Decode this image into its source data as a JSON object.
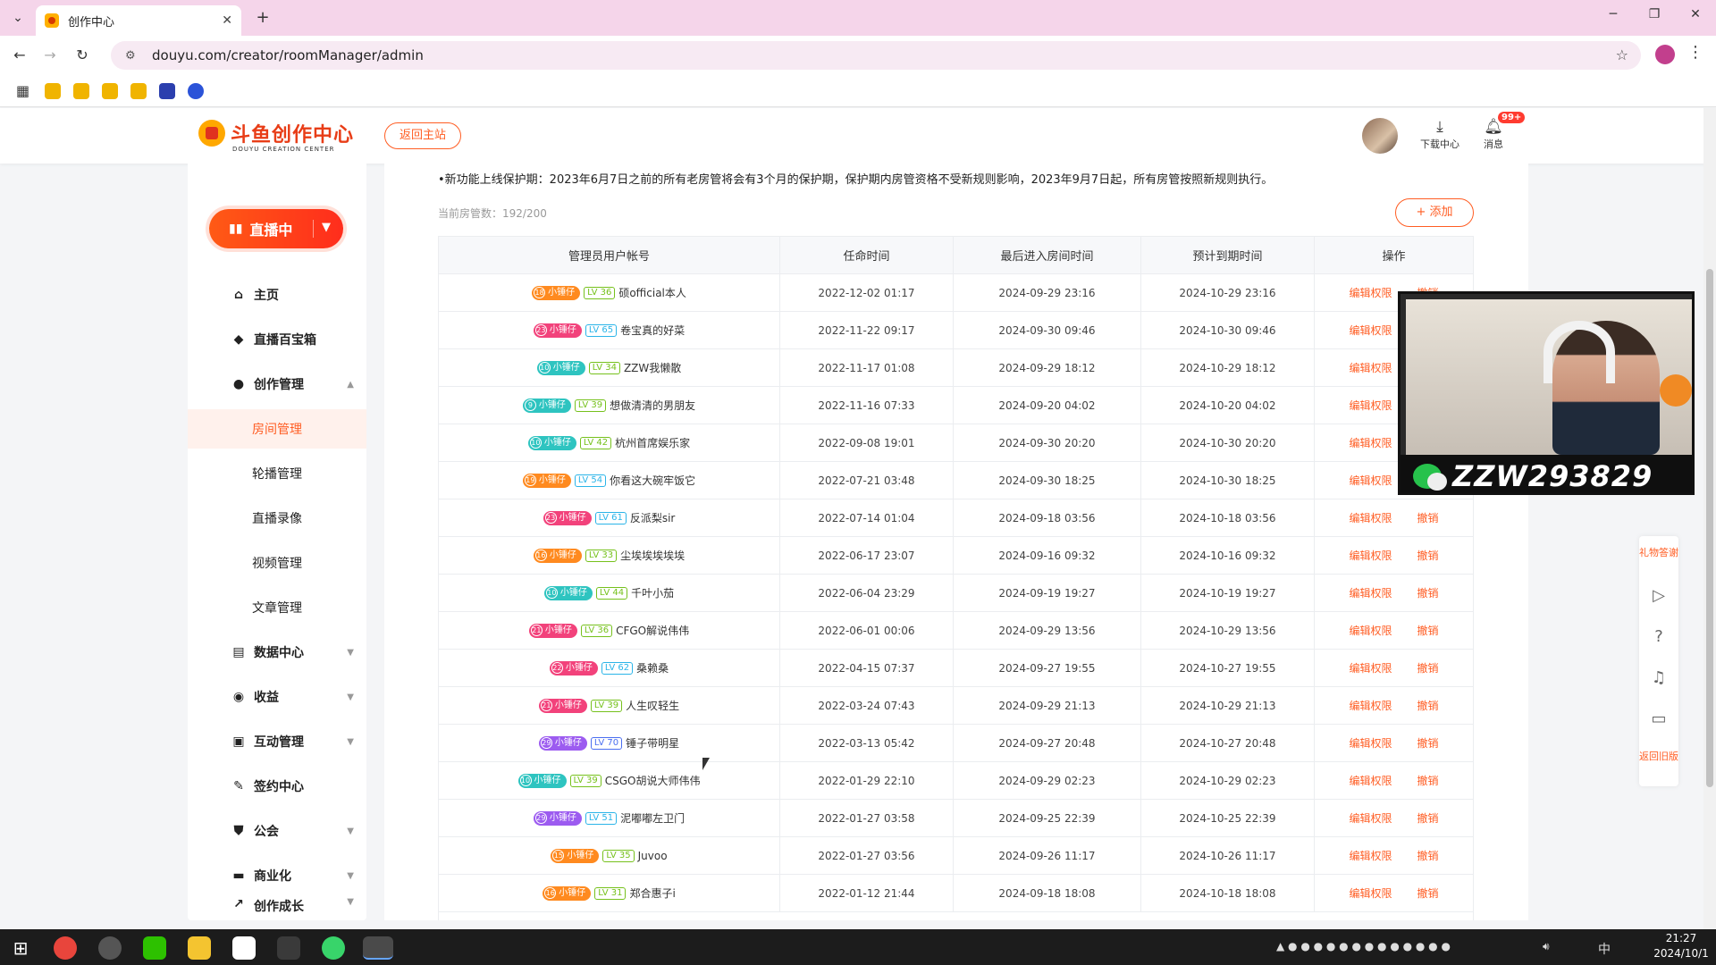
{
  "browser": {
    "tab_title": "创作中心",
    "url": "douyu.com/creator/roomManager/admin"
  },
  "header": {
    "logo_text": "斗鱼创作中心",
    "logo_sub": "DOUYU CREATION CENTER",
    "back_label": "返回主站",
    "download_label": "下载中心",
    "message_label": "消息",
    "message_badge": "99+"
  },
  "sidebar": {
    "live_label": "直播中",
    "items": [
      {
        "label": "主页",
        "icon": "home-icon"
      },
      {
        "label": "直播百宝箱",
        "icon": "box-icon"
      },
      {
        "label": "创作管理",
        "icon": "bulb-icon"
      },
      {
        "label": "房间管理"
      },
      {
        "label": "轮播管理"
      },
      {
        "label": "直播录像"
      },
      {
        "label": "视频管理"
      },
      {
        "label": "文章管理"
      },
      {
        "label": "数据中心",
        "icon": "chart-icon"
      },
      {
        "label": "收益",
        "icon": "coin-icon"
      },
      {
        "label": "互动管理",
        "icon": "chat-icon"
      },
      {
        "label": "签约中心",
        "icon": "sign-icon"
      },
      {
        "label": "公会",
        "icon": "shield-icon"
      },
      {
        "label": "商业化",
        "icon": "wallet-icon"
      },
      {
        "label": "创作成长",
        "icon": "growth-icon"
      }
    ]
  },
  "main": {
    "notice": "•新功能上线保护期：2023年6月7日之前的所有老房管将会有3个月的保护期，保护期内房管资格不受新规则影响，2023年9月7日起，所有房管按照新规则执行。",
    "count": "当前房管数：192/200",
    "add_label": "+ 添加",
    "columns": [
      "管理员用户帐号",
      "任命时间",
      "最后进入房间时间",
      "预计到期时间",
      "操作"
    ],
    "edit_label": "编辑权限",
    "revoke_label": "撤销",
    "rows": [
      {
        "fan_lv": "18",
        "fan_color": "o",
        "lv": "LV 36",
        "lv_color": "g",
        "name": "硕official本人",
        "appoint": "2022-12-02 01:17",
        "last": "2024-09-29 23:16",
        "expire": "2024-10-29 23:16"
      },
      {
        "fan_lv": "23",
        "fan_color": "p",
        "lv": "LV 65",
        "lv_color": "b",
        "name": "卷宝真的好菜",
        "appoint": "2022-11-22 09:17",
        "last": "2024-09-30 09:46",
        "expire": "2024-10-30 09:46"
      },
      {
        "fan_lv": "10",
        "fan_color": "c",
        "lv": "LV 34",
        "lv_color": "g",
        "name": "ZZW我懒散",
        "appoint": "2022-11-17 01:08",
        "last": "2024-09-29 18:12",
        "expire": "2024-10-29 18:12"
      },
      {
        "fan_lv": "9",
        "fan_color": "c",
        "lv": "LV 39",
        "lv_color": "g",
        "name": "想做清清的男朋友",
        "appoint": "2022-11-16 07:33",
        "last": "2024-09-20 04:02",
        "expire": "2024-10-20 04:02"
      },
      {
        "fan_lv": "10",
        "fan_color": "c",
        "lv": "LV 42",
        "lv_color": "g",
        "name": "杭州首席娱乐家",
        "appoint": "2022-09-08 19:01",
        "last": "2024-09-30 20:20",
        "expire": "2024-10-30 20:20"
      },
      {
        "fan_lv": "19",
        "fan_color": "o",
        "lv": "LV 54",
        "lv_color": "b",
        "name": "你看这大碗牢饭它",
        "appoint": "2022-07-21 03:48",
        "last": "2024-09-30 18:25",
        "expire": "2024-10-30 18:25"
      },
      {
        "fan_lv": "23",
        "fan_color": "p",
        "lv": "LV 61",
        "lv_color": "b",
        "name": "反派梨sir",
        "appoint": "2022-07-14 01:04",
        "last": "2024-09-18 03:56",
        "expire": "2024-10-18 03:56"
      },
      {
        "fan_lv": "16",
        "fan_color": "o",
        "lv": "LV 33",
        "lv_color": "g",
        "name": "尘埃埃埃埃埃",
        "appoint": "2022-06-17 23:07",
        "last": "2024-09-16 09:32",
        "expire": "2024-10-16 09:32"
      },
      {
        "fan_lv": "10",
        "fan_color": "c",
        "lv": "LV 44",
        "lv_color": "g",
        "name": "千叶小茄",
        "appoint": "2022-06-04 23:29",
        "last": "2024-09-19 19:27",
        "expire": "2024-10-19 19:27"
      },
      {
        "fan_lv": "21",
        "fan_color": "p",
        "lv": "LV 36",
        "lv_color": "g",
        "name": "CFGO解说伟伟",
        "appoint": "2022-06-01 00:06",
        "last": "2024-09-29 13:56",
        "expire": "2024-10-29 13:56"
      },
      {
        "fan_lv": "22",
        "fan_color": "p",
        "lv": "LV 62",
        "lv_color": "b",
        "name": "桑赖桑",
        "appoint": "2022-04-15 07:37",
        "last": "2024-09-27 19:55",
        "expire": "2024-10-27 19:55"
      },
      {
        "fan_lv": "21",
        "fan_color": "p",
        "lv": "LV 39",
        "lv_color": "g",
        "name": "人生叹轻生",
        "appoint": "2022-03-24 07:43",
        "last": "2024-09-29 21:13",
        "expire": "2024-10-29 21:13"
      },
      {
        "fan_lv": "29",
        "fan_color": "v",
        "lv": "LV 70",
        "lv_color": "d",
        "name": "锤子带明星",
        "appoint": "2022-03-13 05:42",
        "last": "2024-09-27 20:48",
        "expire": "2024-10-27 20:48"
      },
      {
        "fan_lv": "10",
        "fan_color": "c",
        "lv": "LV 39",
        "lv_color": "g",
        "name": "CSGO胡说大师伟伟",
        "appoint": "2022-01-29 22:10",
        "last": "2024-09-29 02:23",
        "expire": "2024-10-29 02:23"
      },
      {
        "fan_lv": "29",
        "fan_color": "v",
        "lv": "LV 51",
        "lv_color": "b",
        "name": "泥嘟嘟左卫门",
        "appoint": "2022-01-27 03:58",
        "last": "2024-09-25 22:39",
        "expire": "2024-10-25 22:39"
      },
      {
        "fan_lv": "15",
        "fan_color": "o",
        "lv": "LV 35",
        "lv_color": "g",
        "name": "Juvoo",
        "appoint": "2022-01-27 03:56",
        "last": "2024-09-26 11:17",
        "expire": "2024-10-26 11:17"
      },
      {
        "fan_lv": "16",
        "fan_color": "o",
        "lv": "LV 31",
        "lv_color": "g",
        "name": "郑合惠子i",
        "appoint": "2022-01-12 21:44",
        "last": "2024-09-18 18:08",
        "expire": "2024-10-18 18:08"
      }
    ],
    "fan_badge_label": "小锤仔"
  },
  "overlay": {
    "stream_id": "ZZW293829"
  },
  "float_tools": {
    "gift_label": "礼物答谢",
    "old_label": "返回旧版"
  },
  "taskbar": {
    "time": "21:27",
    "date": "2024/10/1",
    "ime": "中"
  },
  "colors": {
    "accent": "#ff5d23",
    "fan_orange": "#ff8a1f",
    "fan_pink": "#f2427b",
    "fan_cyan": "#2ec4c0",
    "fan_violet": "#9c5bf0"
  }
}
